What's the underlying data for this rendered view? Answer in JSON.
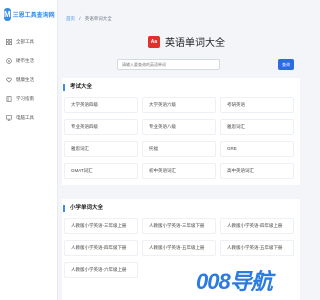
{
  "brand": {
    "logo": "M",
    "name": "三恩工具查询网"
  },
  "sidebar": {
    "items": [
      {
        "label": "全部工具",
        "icon": "grid-icon"
      },
      {
        "label": "硬币生活",
        "icon": "coin-icon"
      },
      {
        "label": "健康生活",
        "icon": "heart-icon"
      },
      {
        "label": "学习指南",
        "icon": "book-icon"
      },
      {
        "label": "电脑工具",
        "icon": "computer-icon"
      }
    ]
  },
  "breadcrumb": [
    "首页",
    "/",
    "英语单词大全"
  ],
  "header": {
    "icon_text": "Aa",
    "title": "英语单词大全"
  },
  "search": {
    "placeholder": "请输入要查询的英语单词",
    "button_label": "查询"
  },
  "sections": [
    {
      "title": "考试大全",
      "cards": [
        "大学英语四级",
        "大学英语六级",
        "考研英语",
        "专业英语四级",
        "专业英语八级",
        "雅思词汇",
        "雅思词汇",
        "托福",
        "GRE",
        "GMAT词汇",
        "初中英语词汇",
        "高中英语词汇"
      ]
    },
    {
      "title": "小学单词大全",
      "cards": [
        "人教版小学英语-三年级上册",
        "人教版小学英语-三年级下册",
        "人教版小学英语-四年级上册",
        "人教版小学英语-四年级下册",
        "人教版小学英语-五年级上册",
        "人教版小学英语-五年级下册",
        "人教版小学英语-六年级上册"
      ]
    }
  ],
  "watermark": {
    "text": "008导航"
  },
  "colors": {
    "accent": "#3a8ee6",
    "button": "#2d6cdf",
    "header_icon": "#e0312a"
  }
}
